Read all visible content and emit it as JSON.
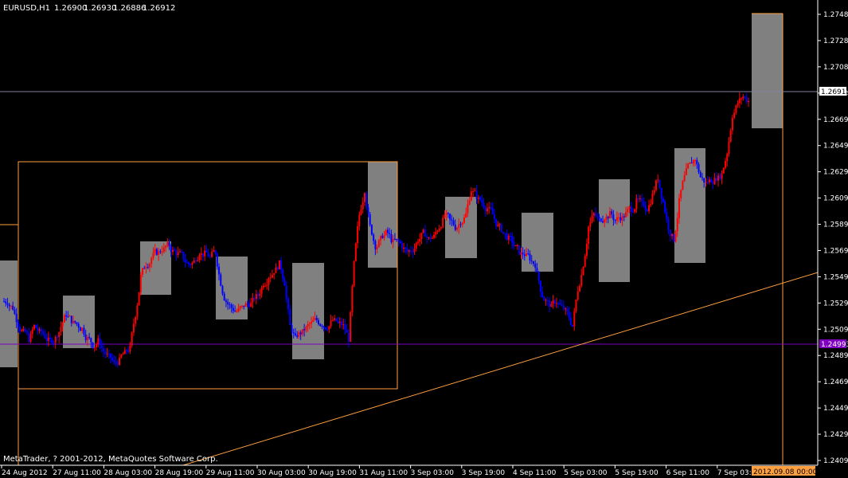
{
  "header": {
    "symbol": "EURUSD,H1",
    "open": "1.26900",
    "high": "1.26930",
    "low": "1.26886",
    "close": "1.26912"
  },
  "copyright": "MetaTrader, ? 2001-2012, MetaQuotes Software Corp.",
  "colors": {
    "background": "#000000",
    "bull_candle": "#ff0000",
    "bear_candle": "#0000ff",
    "box_fill": "#808080",
    "rectangle_stroke": "#ffa040",
    "trendline": "#ffa040",
    "bid_line": "#8080a0",
    "horizontal_line": "#8000c0",
    "axis": "#ffffff"
  },
  "price_axis": {
    "ticks": [
      "1.27485",
      "1.27285",
      "1.27085",
      "1.26890",
      "1.26690",
      "1.26490",
      "1.26290",
      "1.26090",
      "1.25890",
      "1.25690",
      "1.25490",
      "1.25290",
      "1.25090",
      "1.24895",
      "1.24695",
      "1.24495",
      "1.24295",
      "1.24095"
    ],
    "current_price": "1.26912",
    "line_price": "1.24993"
  },
  "time_axis": {
    "labels": [
      "24 Aug 2012",
      "27 Aug 11:00",
      "28 Aug 03:00",
      "28 Aug 19:00",
      "29 Aug 11:00",
      "30 Aug 03:00",
      "30 Aug 19:00",
      "31 Aug 11:00",
      "3 Sep 03:00",
      "3 Sep 19:00",
      "4 Sep 11:00",
      "5 Sep 03:00",
      "5 Sep 19:00",
      "6 Sep 11:00",
      "7 Sep 03:00"
    ],
    "cursor_label": "2012.09.08 00:00"
  },
  "chart_data": {
    "type": "candlestick",
    "symbol": "EURUSD",
    "timeframe": "H1",
    "ylim": [
      1.2402,
      1.2761
    ],
    "grid": false,
    "close_path": [
      1.253,
      1.2525,
      1.2512,
      1.2505,
      1.25,
      1.251,
      1.2505,
      1.2502,
      1.2498,
      1.25,
      1.251,
      1.252,
      1.2515,
      1.2512,
      1.2508,
      1.25,
      1.2495,
      1.2498,
      1.249,
      1.2485,
      1.248,
      1.2482,
      1.2488,
      1.2492,
      1.252,
      1.255,
      1.256,
      1.2565,
      1.257,
      1.2572,
      1.2575,
      1.257,
      1.2568,
      1.2565,
      1.256,
      1.2562,
      1.257,
      1.2568,
      1.2565,
      1.257,
      1.2545,
      1.253,
      1.2525,
      1.2522,
      1.2525,
      1.2528,
      1.253,
      1.2535,
      1.2545,
      1.255,
      1.2555,
      1.256,
      1.2545,
      1.251,
      1.25,
      1.2505,
      1.2508,
      1.2512,
      1.2515,
      1.2512,
      1.251,
      1.2515,
      1.2512,
      1.251,
      1.25,
      1.256,
      1.26,
      1.262,
      1.259,
      1.2575,
      1.258,
      1.2585,
      1.258,
      1.2578,
      1.2575,
      1.257,
      1.2572,
      1.258,
      1.2585,
      1.258,
      1.2582,
      1.259,
      1.26,
      1.2595,
      1.259,
      1.2595,
      1.26,
      1.262,
      1.2615,
      1.261,
      1.2605,
      1.26,
      1.259,
      1.2585,
      1.258,
      1.2575,
      1.257,
      1.2568,
      1.2565,
      1.256,
      1.254,
      1.253,
      1.2525,
      1.253,
      1.2525,
      1.252,
      1.251,
      1.254,
      1.256,
      1.259,
      1.26,
      1.2595,
      1.2598,
      1.26,
      1.2595,
      1.2598,
      1.26,
      1.2605,
      1.261,
      1.2608,
      1.2605,
      1.2615,
      1.263,
      1.261,
      1.259,
      1.258,
      1.261,
      1.263,
      1.264,
      1.2645,
      1.263,
      1.2625,
      1.2628,
      1.263,
      1.2632,
      1.265,
      1.268,
      1.269,
      1.2695,
      1.2691
    ]
  }
}
